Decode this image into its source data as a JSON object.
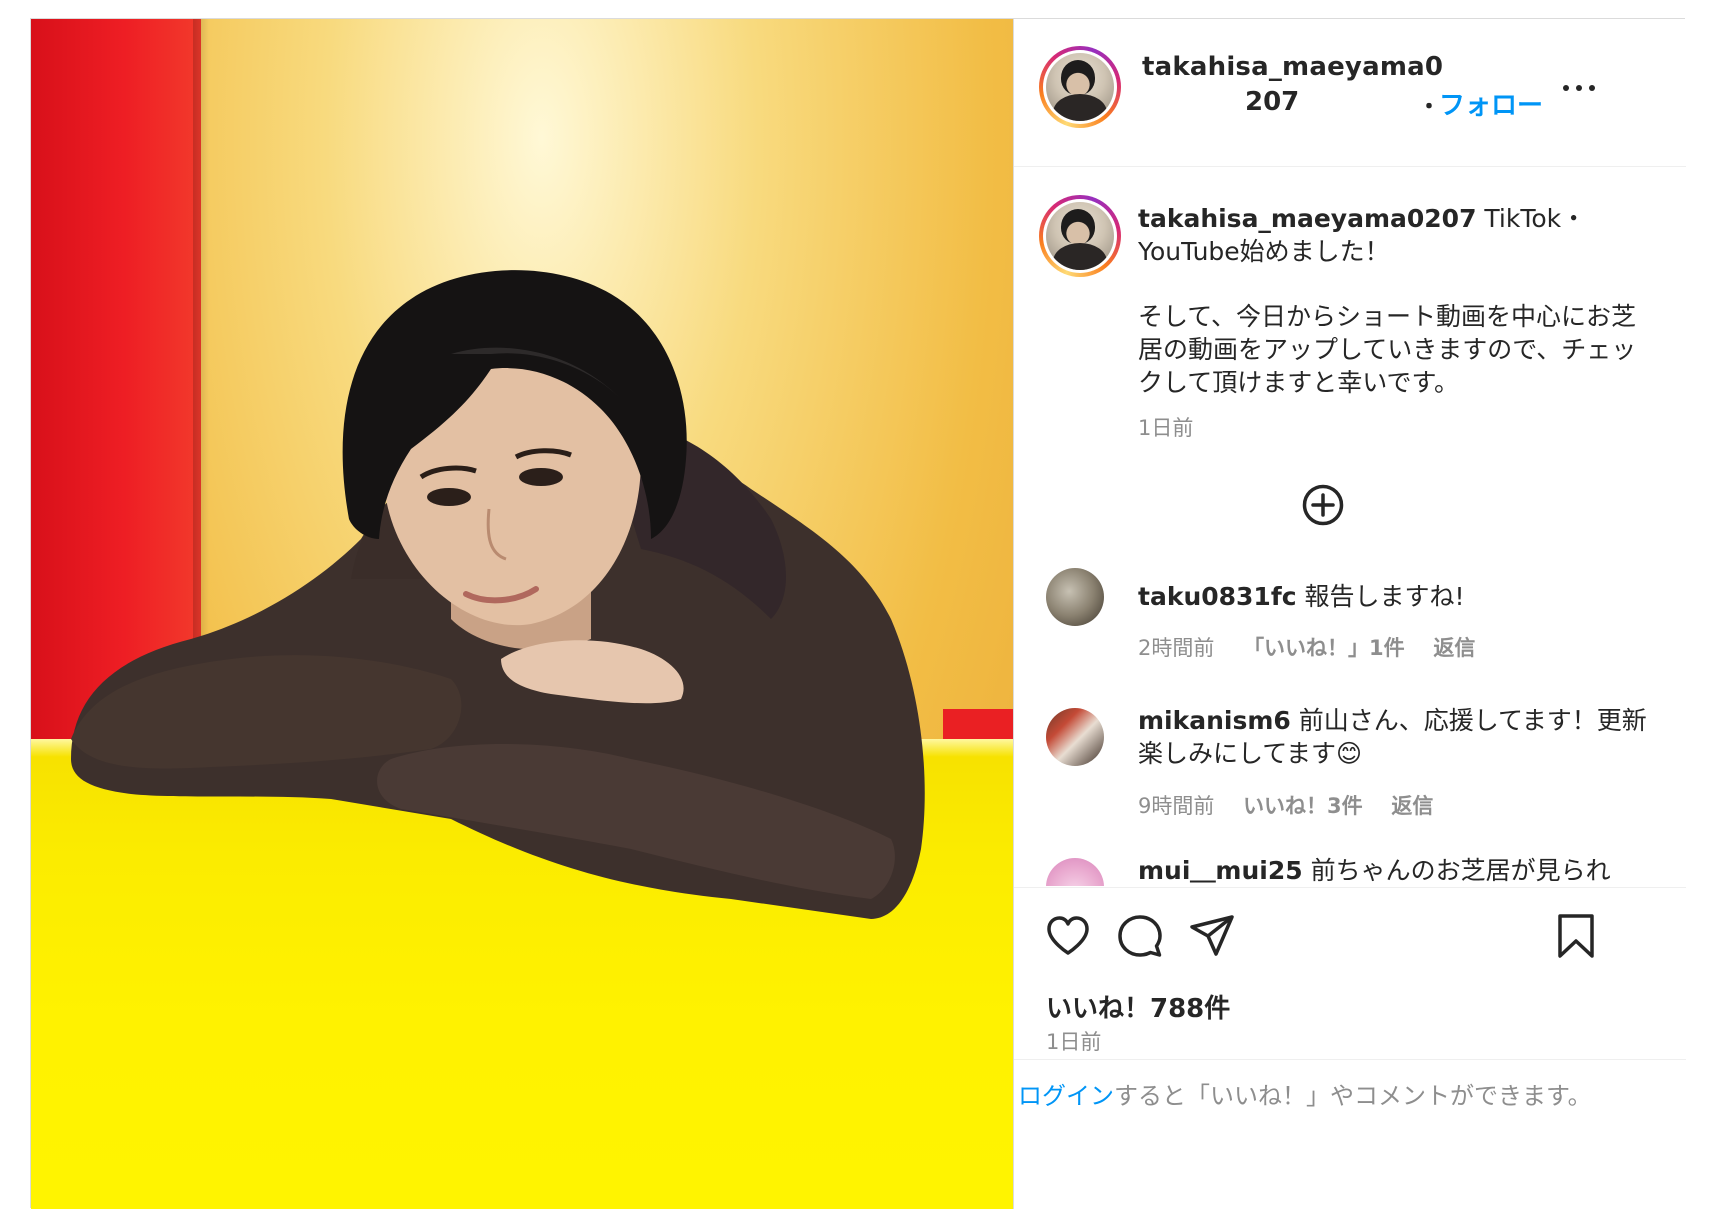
{
  "header": {
    "username_part1": "takahisa_maeyama0",
    "username_part2": "207",
    "dot": "・",
    "follow_label": "フォロー",
    "more_icon": "more-horizontal-icon"
  },
  "caption": {
    "username": "takahisa_maeyama0207",
    "headline": " TikTok・YouTube始めました！",
    "body": "そして、今日からショート動画を中心にお芝居の動画をアップしていきますので、チェックして頂けますと幸いです。",
    "time": "1日前"
  },
  "load_more_icon": "plus-circle-icon",
  "comments": [
    {
      "username": "taku0831fc",
      "text": " 報告しますね!",
      "time": "2時間前",
      "likes": "「いいね！」1件",
      "reply": "返信"
    },
    {
      "username": "mikanism6",
      "text": " 前山さん、応援してます！更新楽しみにしてます😊",
      "time": "9時間前",
      "likes": "いいね！3件",
      "reply": "返信"
    },
    {
      "username": "mui＿mui25",
      "text": " 前ちゃんのお芝居が見られ"
    }
  ],
  "actions": {
    "like_icon": "heart-icon",
    "comment_icon": "comment-icon",
    "share_icon": "send-icon",
    "save_icon": "bookmark-icon",
    "likes": "いいね！788件",
    "time": "1日前"
  },
  "login": {
    "link": "ログイン",
    "rest": "すると「いいね！」やコメントができます。"
  },
  "colors": {
    "link_blue": "#0095f6",
    "text": "#262626",
    "muted": "#8e8e8e",
    "border": "#dbdbdb"
  }
}
